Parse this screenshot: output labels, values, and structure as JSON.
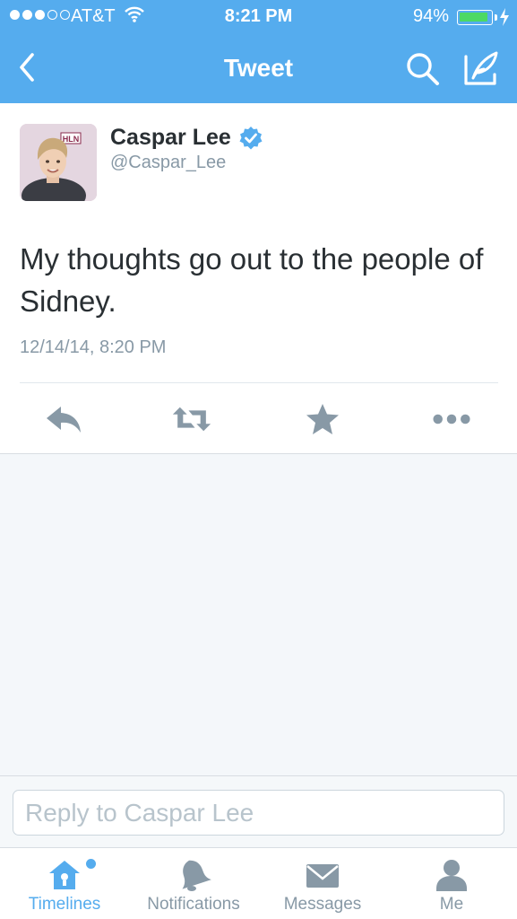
{
  "status_bar": {
    "carrier": "AT&T",
    "time": "8:21 PM",
    "battery_percent_label": "94%",
    "battery_level": 0.94,
    "signal_bars": 3,
    "signal_total": 5
  },
  "nav": {
    "title": "Tweet",
    "back_icon": "chevron-left-icon",
    "search_icon": "search-icon",
    "compose_icon": "compose-icon",
    "bar_color": "#55acee"
  },
  "tweet": {
    "author_name": "Caspar Lee",
    "verified": true,
    "author_handle": "@Caspar_Lee",
    "text": "My thoughts go out to the people of Sidney.",
    "timestamp": "12/14/14, 8:20 PM",
    "avatar_badge": "HLN",
    "actions": [
      "reply-icon",
      "retweet-icon",
      "favorite-icon",
      "more-icon"
    ]
  },
  "reply": {
    "placeholder": "Reply to Caspar Lee",
    "value": ""
  },
  "tabbar": {
    "tabs": [
      {
        "label": "Timelines",
        "icon": "home-icon",
        "active": true,
        "unread": true
      },
      {
        "label": "Notifications",
        "icon": "bell-icon",
        "active": false
      },
      {
        "label": "Messages",
        "icon": "envelope-icon",
        "active": false
      },
      {
        "label": "Me",
        "icon": "person-icon",
        "active": false
      }
    ]
  },
  "colors": {
    "accent": "#55acee",
    "icon_gray": "#8899a6",
    "text": "#292f33",
    "battery_green": "#4cd964"
  }
}
